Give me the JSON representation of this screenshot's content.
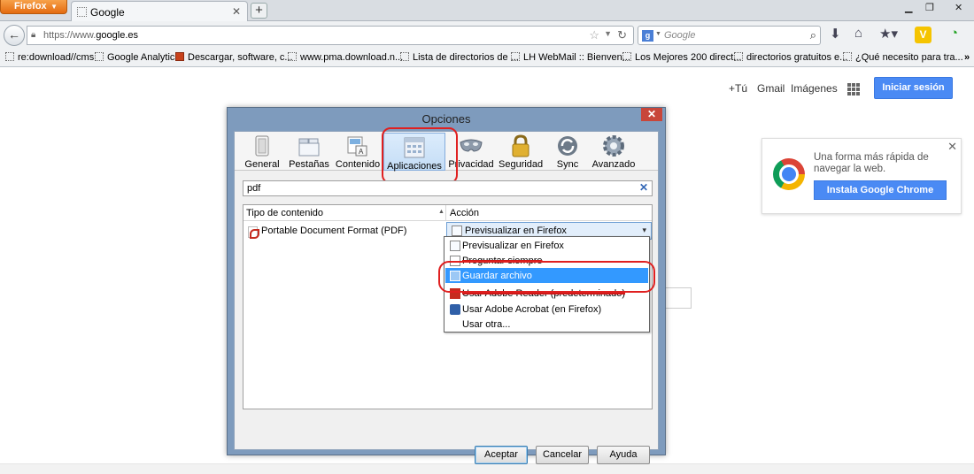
{
  "browser": {
    "menu_button": "Firefox",
    "tab_title": "Google",
    "new_tab": "+",
    "win_min": "▁",
    "win_max": "❐",
    "win_close": "✕",
    "url_prefix": "https://www.",
    "url_domain": "google.es",
    "search_placeholder": "Google",
    "search_engine_glyph": "g",
    "bookmarks": [
      "re:download//cms",
      "Google Analytics",
      "Descargar, software, c...",
      "www.pma.download.n...",
      "Lista de directorios de ...",
      "LH WebMail :: Bienven...",
      "Los Mejores 200 direct...",
      "directorios gratuitos e...",
      "¿Qué necesito para tra..."
    ],
    "bookmarks_overflow": "»"
  },
  "google": {
    "plus_you": "+Tú",
    "gmail": "Gmail",
    "images": "Imágenes",
    "signin": "Iniciar sesión",
    "promo_text": "Una forma más rápida de navegar la web.",
    "promo_button": "Instala Google Chrome",
    "promo_close": "✕"
  },
  "dialog": {
    "title": "Opciones",
    "close": "✕",
    "panes": [
      "General",
      "Pestañas",
      "Contenido",
      "Aplicaciones",
      "Privacidad",
      "Seguridad",
      "Sync",
      "Avanzado"
    ],
    "selected_pane": "Aplicaciones",
    "filter_value": "pdf",
    "filter_clear": "✕",
    "col_content_type": "Tipo de contenido",
    "col_action": "Acción",
    "sort_glyph": "▲",
    "row_content_type": "Portable Document Format (PDF)",
    "row_action": "Previsualizar en Firefox",
    "dropdown_glyph": "▾",
    "options": [
      "Previsualizar en Firefox",
      "Preguntar siempre",
      "Guardar archivo",
      "Usar Adobe Reader  (predeterminado)",
      "Usar Adobe Acrobat (en Firefox)",
      "Usar otra..."
    ],
    "highlighted_option": "Guardar archivo",
    "btn_ok": "Aceptar",
    "btn_cancel": "Cancelar",
    "btn_help": "Ayuda"
  },
  "colors": {
    "firefox_orange": "#e46b10",
    "google_blue": "#4a8af4",
    "selection_blue": "#3399ff",
    "annotation_red": "#e02020"
  }
}
